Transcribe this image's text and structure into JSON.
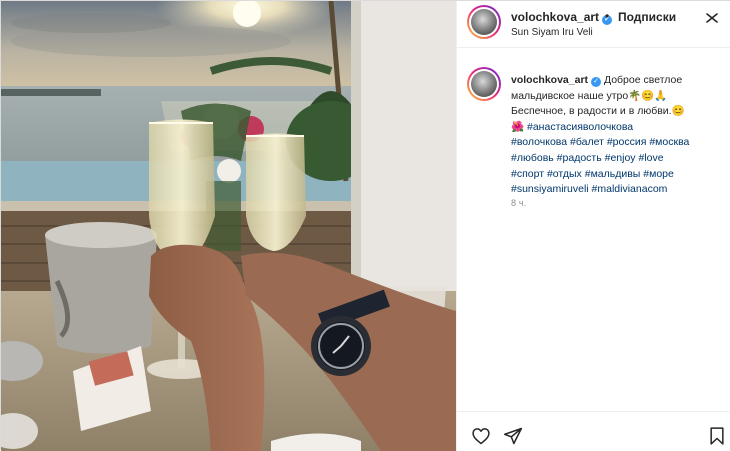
{
  "post": {
    "username": "volochkova_art",
    "separator": "•",
    "follow_label": "Подписки",
    "location": "Sun Siyam Iru Veli",
    "caption": {
      "username": "volochkova_art",
      "line1": "Доброе светлое",
      "line2": "мальдивское наше утро🌴😊🙏",
      "line3": "Беспечное, в радости и в любви.😊",
      "hashtag_lines": [
        [
          "#анастасияволочкова"
        ],
        [
          "#волочкова",
          "#балет",
          "#россия",
          "#москва"
        ],
        [
          "#любовь",
          "#радость",
          "#enjoy",
          "#love"
        ],
        [
          "#спорт",
          "#отдых",
          "#мальдивы",
          "#море"
        ],
        [
          "#sunsiyamiruveli",
          "#maldivianacom"
        ]
      ],
      "hashtag_flower": "🌺",
      "time": "8 ч."
    }
  },
  "icons": {
    "verified": "verified-badge-icon",
    "more": "more-options-icon",
    "like": "heart-icon",
    "share": "send-icon",
    "save": "bookmark-icon"
  },
  "colors": {
    "hashtag": "#00376b",
    "verified": "#3897f0",
    "text": "#262626",
    "muted": "#8e8e8e"
  }
}
